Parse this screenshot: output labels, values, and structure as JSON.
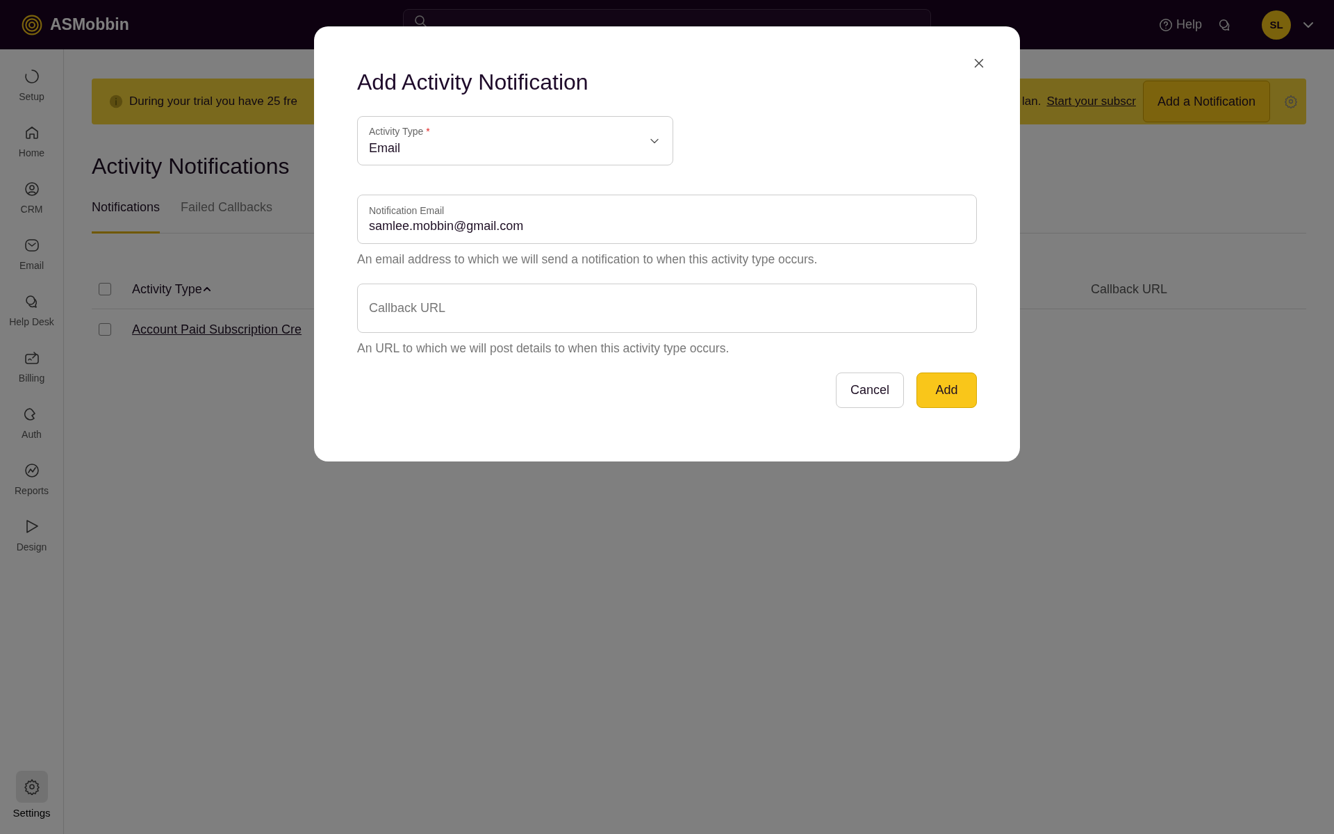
{
  "topbar": {
    "logo": "ASMobbin",
    "help": "Help",
    "avatar": "SL"
  },
  "sidebar": {
    "items": [
      {
        "label": "Setup",
        "selected": false
      },
      {
        "label": "Home",
        "selected": false
      },
      {
        "label": "CRM",
        "selected": false
      },
      {
        "label": "Email",
        "selected": false
      },
      {
        "label": "Help Desk",
        "selected": false
      },
      {
        "label": "Billing",
        "selected": false
      },
      {
        "label": "Auth",
        "selected": false
      },
      {
        "label": "Reports",
        "selected": false
      },
      {
        "label": "Design",
        "selected": false
      }
    ],
    "bottom_items": [
      {
        "label": "Settings",
        "selected": true
      }
    ]
  },
  "banner": {
    "text_left": "During your trial you have 25 fre",
    "text_right": "lan.",
    "link": "Start your subscr",
    "button": "Add a Notification"
  },
  "page": {
    "title": "Activity Notifications",
    "tabs": [
      {
        "label": "Notifications",
        "selected": true
      },
      {
        "label": "Failed Callbacks",
        "selected": false
      }
    ]
  },
  "table": {
    "header_checked": false,
    "columns": [
      {
        "label": "Activity Type",
        "sort_ascending": true
      },
      {
        "label": "Callback URL",
        "sort_ascending": false
      }
    ],
    "rows": [
      {
        "checked": false,
        "activity_type": "Account Paid Subscription Cre"
      }
    ]
  },
  "modal": {
    "title": "Add Activity Notification",
    "fields": [
      {
        "kind": "select",
        "label": "Activity Type",
        "required_mark": "*",
        "value": "Email"
      },
      {
        "kind": "text",
        "label": "Notification Email",
        "value": "samlee.mobbin@gmail.com",
        "help": "An email address to which we will send a notification to when this activity type occurs."
      },
      {
        "kind": "text",
        "placeholder": "Callback URL",
        "help": "An URL to which we will post details to when this activity type occurs."
      }
    ],
    "buttons": [
      {
        "label": "Cancel",
        "kind": "secondary"
      },
      {
        "label": "Add",
        "kind": "primary"
      }
    ]
  }
}
